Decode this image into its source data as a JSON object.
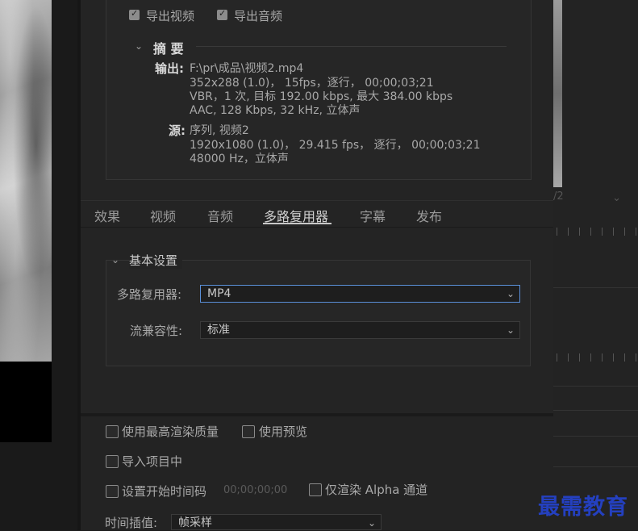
{
  "export_options": {
    "export_video_label": "导出视频",
    "export_video_checked": true,
    "export_audio_label": "导出音频",
    "export_audio_checked": true
  },
  "summary": {
    "title": "摘 要",
    "output_key": "输出:",
    "output_lines": [
      "F:\\pr\\成品\\视频2.mp4",
      "352x288 (1.0)， 15fps，逐行， 00;00;03;21",
      "VBR，1 次, 目标 192.00 kbps, 最大 384.00 kbps",
      "AAC, 128 Kbps, 32  kHz, 立体声"
    ],
    "source_key": "源:",
    "source_lines": [
      "序列, 视频2",
      "1920x1080 (1.0)， 29.415 fps， 逐行， 00;00;03;21",
      "48000 Hz，立体声"
    ]
  },
  "tabs": [
    {
      "label": "效果"
    },
    {
      "label": "视频"
    },
    {
      "label": "音频"
    },
    {
      "label": "多路复用器",
      "active": true
    },
    {
      "label": "字幕"
    },
    {
      "label": "发布"
    }
  ],
  "basic_settings": {
    "title": "基本设置",
    "multiplexer_label": "多路复用器:",
    "multiplexer_value": "MP4",
    "compat_label": "流兼容性:",
    "compat_value": "标准"
  },
  "bottom_options": {
    "max_render_quality": "使用最高渲染质量",
    "use_previews": "使用预览",
    "import_into_project": "导入项目中",
    "set_start_timecode": "设置开始时间码",
    "start_timecode_value": "00;00;00;00",
    "render_alpha_only": "仅渲染 Alpha 通道",
    "time_interpolation_label": "时间插值:",
    "time_interpolation_value": "帧采样"
  },
  "right_panel": {
    "dropdown_value": "/2"
  },
  "watermark": "最需教育",
  "colors": {
    "background": "#1d1d1d",
    "panel": "#242424",
    "focus_border": "#5a8fd8",
    "watermark": "#2440c0"
  }
}
